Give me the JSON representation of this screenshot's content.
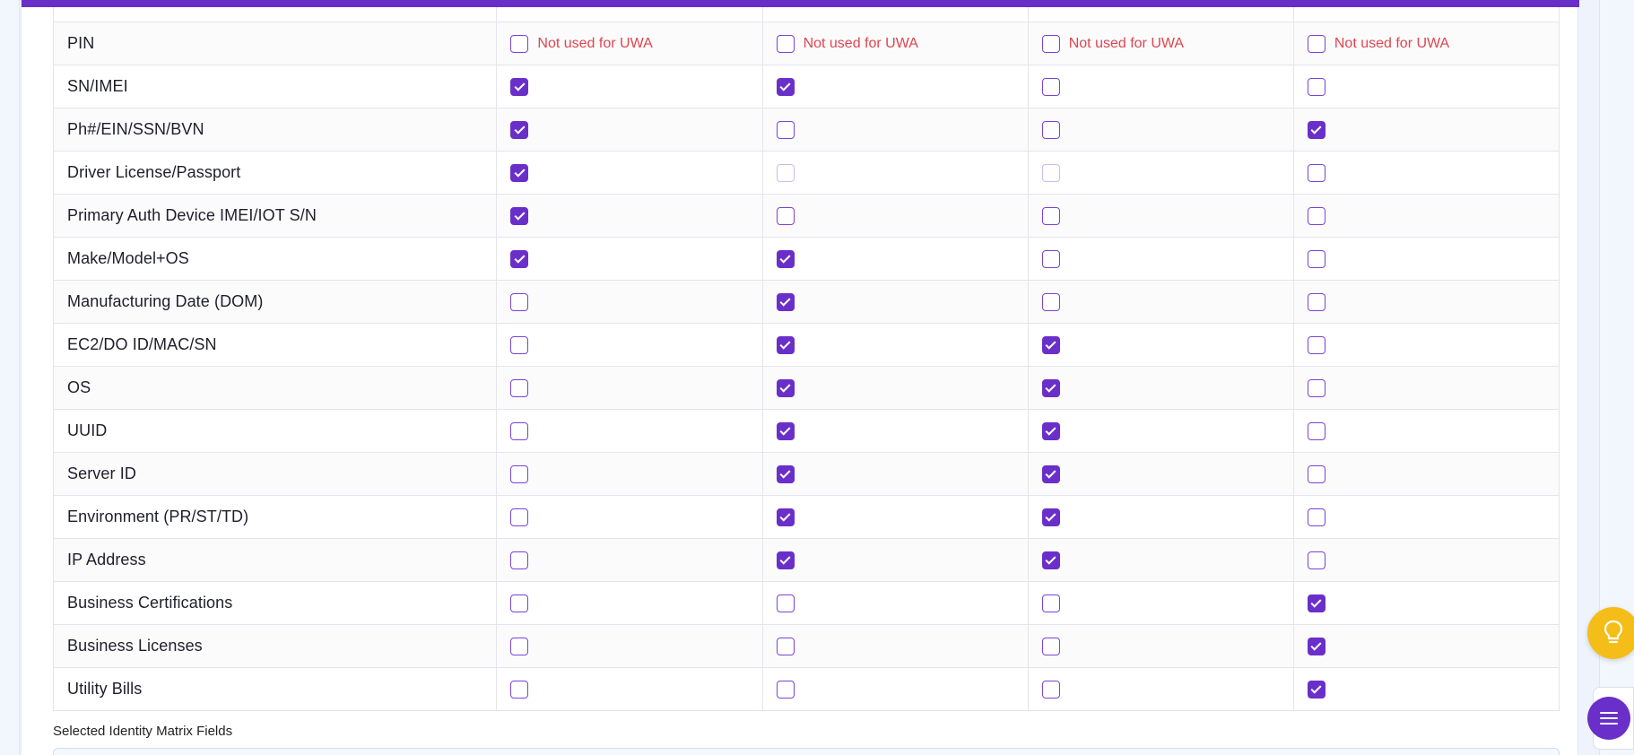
{
  "matrix": {
    "rows": [
      {
        "label": "PIN",
        "cells": [
          {
            "checked": false,
            "note": "Not used for UWA"
          },
          {
            "checked": false,
            "note": "Not used for UWA"
          },
          {
            "checked": false,
            "note": "Not used for UWA"
          },
          {
            "checked": false,
            "note": "Not used for UWA"
          }
        ]
      },
      {
        "label": "SN/IMEI",
        "cells": [
          {
            "checked": true
          },
          {
            "checked": true
          },
          {
            "checked": false
          },
          {
            "checked": false
          }
        ]
      },
      {
        "label": "Ph#/EIN/SSN/BVN",
        "cells": [
          {
            "checked": true
          },
          {
            "checked": false
          },
          {
            "checked": false
          },
          {
            "checked": true
          }
        ]
      },
      {
        "label": "Driver License/Passport",
        "cells": [
          {
            "checked": true
          },
          {
            "checked": false,
            "disabled": true
          },
          {
            "checked": false,
            "disabled": true
          },
          {
            "checked": false
          }
        ]
      },
      {
        "label": "Primary Auth Device IMEI/IOT S/N",
        "cells": [
          {
            "checked": true
          },
          {
            "checked": false
          },
          {
            "checked": false
          },
          {
            "checked": false
          }
        ]
      },
      {
        "label": "Make/Model+OS",
        "cells": [
          {
            "checked": true
          },
          {
            "checked": true
          },
          {
            "checked": false
          },
          {
            "checked": false
          }
        ]
      },
      {
        "label": "Manufacturing Date (DOM)",
        "cells": [
          {
            "checked": false
          },
          {
            "checked": true
          },
          {
            "checked": false
          },
          {
            "checked": false
          }
        ]
      },
      {
        "label": "EC2/DO ID/MAC/SN",
        "cells": [
          {
            "checked": false
          },
          {
            "checked": true
          },
          {
            "checked": true
          },
          {
            "checked": false
          }
        ]
      },
      {
        "label": "OS",
        "cells": [
          {
            "checked": false
          },
          {
            "checked": true
          },
          {
            "checked": true
          },
          {
            "checked": false
          }
        ]
      },
      {
        "label": "UUID",
        "cells": [
          {
            "checked": false
          },
          {
            "checked": true
          },
          {
            "checked": true
          },
          {
            "checked": false
          }
        ]
      },
      {
        "label": "Server ID",
        "cells": [
          {
            "checked": false
          },
          {
            "checked": true
          },
          {
            "checked": true
          },
          {
            "checked": false
          }
        ]
      },
      {
        "label": "Environment (PR/ST/TD)",
        "cells": [
          {
            "checked": false
          },
          {
            "checked": true
          },
          {
            "checked": true
          },
          {
            "checked": false
          }
        ]
      },
      {
        "label": "IP Address",
        "cells": [
          {
            "checked": false
          },
          {
            "checked": true
          },
          {
            "checked": true
          },
          {
            "checked": false
          }
        ]
      },
      {
        "label": "Business Certifications",
        "cells": [
          {
            "checked": false
          },
          {
            "checked": false
          },
          {
            "checked": false
          },
          {
            "checked": true
          }
        ]
      },
      {
        "label": "Business Licenses",
        "cells": [
          {
            "checked": false
          },
          {
            "checked": false
          },
          {
            "checked": false
          },
          {
            "checked": true
          }
        ]
      },
      {
        "label": "Utility Bills",
        "cells": [
          {
            "checked": false
          },
          {
            "checked": false
          },
          {
            "checked": false
          },
          {
            "checked": true
          }
        ]
      }
    ]
  },
  "selected_section": {
    "title": "Selected Identity Matrix Fields"
  },
  "fab": {
    "help_icon": "lightbulb-icon",
    "menu_icon": "menu-icon"
  },
  "colors": {
    "accent": "#6a2fc9",
    "note": "#e0454f",
    "help": "#f5bd18"
  }
}
